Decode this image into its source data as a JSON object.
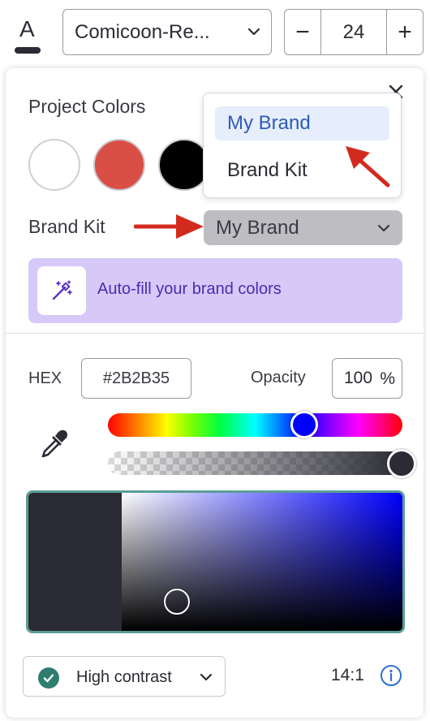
{
  "toolbar": {
    "text_color_glyph": "A",
    "font_name": "Comicoon-Re...",
    "font_size": "24",
    "minus_label": "−",
    "plus_label": "+"
  },
  "panel": {
    "project_colors_title": "Project Colors",
    "swatches": [
      {
        "name": "white",
        "color": "#ffffff"
      },
      {
        "name": "red",
        "color": "#d94f46"
      },
      {
        "name": "black",
        "color": "#000000"
      }
    ],
    "brand_kit_label": "Brand Kit",
    "brand_kit_selected": "My Brand",
    "autofill_label": "Auto-fill your brand colors",
    "hex_label": "HEX",
    "hex_value": "#2B2B35",
    "opacity_label": "Opacity",
    "opacity_value": "100",
    "opacity_unit": "%",
    "hue_color": "#0000ff",
    "selected_color": "#2B2B35",
    "contrast_label": "High contrast",
    "contrast_ratio": "14:1"
  },
  "brand_menu": {
    "items": [
      "My Brand",
      "Brand Kit"
    ],
    "active_index": 0
  },
  "colors": {
    "accent_purple": "#d6c9f8",
    "picker_border": "#5a9e95",
    "annotation_red": "#d22b1e",
    "check_green": "#2f7d70",
    "info_blue": "#2f6fd0"
  },
  "icons": [
    "text-color-icon",
    "chevron-down-icon",
    "close-icon",
    "magic-wand-icon",
    "eyedropper-icon",
    "check-icon",
    "info-icon"
  ]
}
